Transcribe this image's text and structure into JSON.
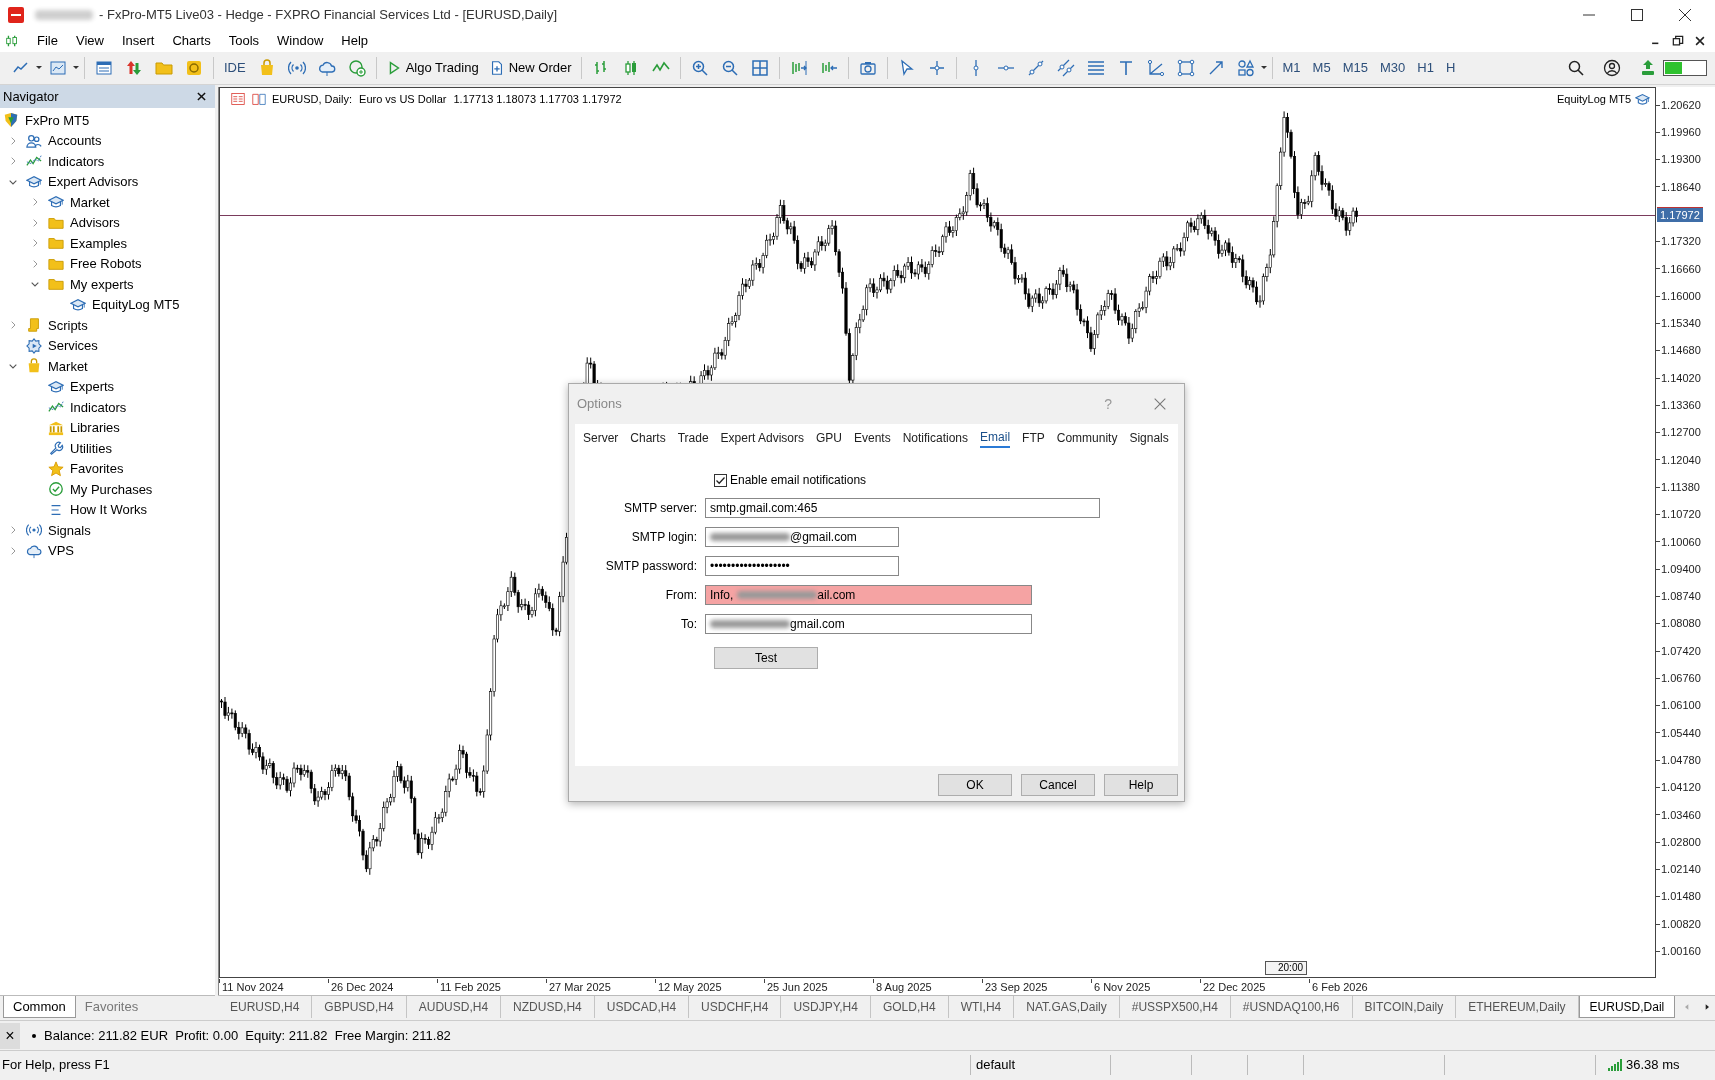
{
  "window": {
    "title": "- FxPro-MT5 Live03 - Hedge - FXPRO Financial Services Ltd - [EURUSD,Daily]"
  },
  "menu": [
    "File",
    "View",
    "Insert",
    "Charts",
    "Tools",
    "Window",
    "Help"
  ],
  "toolbar": {
    "buttons": [
      {
        "label": "IDE"
      },
      {
        "label": "Algo Trading"
      },
      {
        "label": "New Order"
      }
    ],
    "timeframes": [
      "M1",
      "M5",
      "M15",
      "M30",
      "H1",
      "H"
    ]
  },
  "navigator": {
    "title": "Navigator",
    "tree": [
      {
        "label": "FxPro MT5",
        "children": [
          {
            "label": "Accounts",
            "expanded": false
          },
          {
            "label": "Indicators",
            "expanded": false
          },
          {
            "label": "Expert Advisors",
            "expanded": true,
            "children": [
              {
                "label": "Market",
                "expanded": false
              },
              {
                "label": "Advisors",
                "expanded": false
              },
              {
                "label": "Examples",
                "expanded": false
              },
              {
                "label": "Free Robots",
                "expanded": false
              },
              {
                "label": "My experts",
                "expanded": true,
                "children": [
                  {
                    "label": "EquityLog MT5"
                  }
                ]
              }
            ]
          },
          {
            "label": "Scripts",
            "expanded": false
          },
          {
            "label": "Services"
          },
          {
            "label": "Market",
            "expanded": true,
            "children": [
              {
                "label": "Experts"
              },
              {
                "label": "Indicators"
              },
              {
                "label": "Libraries"
              },
              {
                "label": "Utilities"
              },
              {
                "label": "Favorites"
              },
              {
                "label": "My Purchases"
              },
              {
                "label": "How It Works"
              }
            ]
          },
          {
            "label": "Signals",
            "expanded": false
          },
          {
            "label": "VPS",
            "expanded": false
          }
        ]
      }
    ],
    "tabs": [
      {
        "label": "Common",
        "selected": true
      },
      {
        "label": "Favorites",
        "selected": false
      }
    ]
  },
  "chart": {
    "symbol": "EURUSD, Daily:",
    "description": "Euro vs US Dollar",
    "ohlc": "1.17713 1.18073 1.17703 1.17972",
    "expert": "EquityLog MT5",
    "current_price": "1.17972",
    "price_axis": [
      "1.20620",
      "1.19960",
      "1.19300",
      "1.18640",
      "1.17320",
      "1.16660",
      "1.16000",
      "1.15340",
      "1.14680",
      "1.14020",
      "1.13360",
      "1.12700",
      "1.12040",
      "1.11380",
      "1.10720",
      "1.10060",
      "1.09400",
      "1.08740",
      "1.08080",
      "1.07420",
      "1.06760",
      "1.06100",
      "1.05440",
      "1.04780",
      "1.04120",
      "1.03460",
      "1.02800",
      "1.02140",
      "1.01480",
      "1.00820",
      "1.00160"
    ],
    "time_axis": [
      "11 Nov 2024",
      "26 Dec 2024",
      "11 Feb 2025",
      "27 Mar 2025",
      "12 May 2025",
      "25 Jun 2025",
      "8 Aug 2025",
      "23 Sep 2025",
      "6 Nov 2025",
      "22 Dec 2025",
      "6 Feb 2026"
    ],
    "scroll_marker": "20:00"
  },
  "options_dialog": {
    "title": "Options",
    "help": "?",
    "tabs": [
      {
        "label": "Server",
        "selected": false
      },
      {
        "label": "Charts",
        "selected": false
      },
      {
        "label": "Trade",
        "selected": false
      },
      {
        "label": "Expert Advisors",
        "selected": false
      },
      {
        "label": "GPU",
        "selected": false
      },
      {
        "label": "Events",
        "selected": false
      },
      {
        "label": "Notifications",
        "selected": false
      },
      {
        "label": "Email",
        "selected": true
      },
      {
        "label": "FTP",
        "selected": false
      },
      {
        "label": "Community",
        "selected": false
      },
      {
        "label": "Signals",
        "selected": false
      }
    ],
    "enable_email": {
      "label": "Enable email notifications",
      "checked": true
    },
    "fields": [
      {
        "label": "SMTP server:",
        "value": "smtp.gmail.com:465",
        "redacted": false,
        "invalid": false
      },
      {
        "label": "SMTP login:",
        "value": "@gmail.com",
        "redacted": true,
        "invalid": false
      },
      {
        "label": "SMTP password:",
        "value": "•••••••••••••••••••",
        "redacted": false,
        "invalid": false
      },
      {
        "label": "From:",
        "prefix": "Info,",
        "value": "ail.com",
        "redacted": true,
        "invalid": true
      },
      {
        "label": "To:",
        "value": "gmail.com",
        "redacted": true,
        "invalid": false
      }
    ],
    "test_button": "Test",
    "buttons": [
      "OK",
      "Cancel",
      "Help"
    ]
  },
  "symbol_tabs": [
    {
      "label": "EURUSD,H4",
      "selected": false
    },
    {
      "label": "GBPUSD,H4",
      "selected": false
    },
    {
      "label": "AUDUSD,H4",
      "selected": false
    },
    {
      "label": "NZDUSD,H4",
      "selected": false
    },
    {
      "label": "USDCAD,H4",
      "selected": false
    },
    {
      "label": "USDCHF,H4",
      "selected": false
    },
    {
      "label": "USDJPY,H4",
      "selected": false
    },
    {
      "label": "GOLD,H4",
      "selected": false
    },
    {
      "label": "WTI,H4",
      "selected": false
    },
    {
      "label": "NAT.GAS,Daily",
      "selected": false
    },
    {
      "label": "#USSPX500,H4",
      "selected": false
    },
    {
      "label": "#USNDAQ100,H6",
      "selected": false
    },
    {
      "label": "BITCOIN,Daily",
      "selected": false
    },
    {
      "label": "ETHEREUM,Daily",
      "selected": false
    },
    {
      "label": "EURUSD,Dail",
      "selected": true
    }
  ],
  "toolbox": {
    "close": "×",
    "account": "Balance: 211.82 EUR  Profit: 0.00  Equity: 211.82  Free Margin: 211.82"
  },
  "status_bar": {
    "help": "For Help, press F1",
    "profile": "default",
    "ping": "36.38 ms"
  }
}
